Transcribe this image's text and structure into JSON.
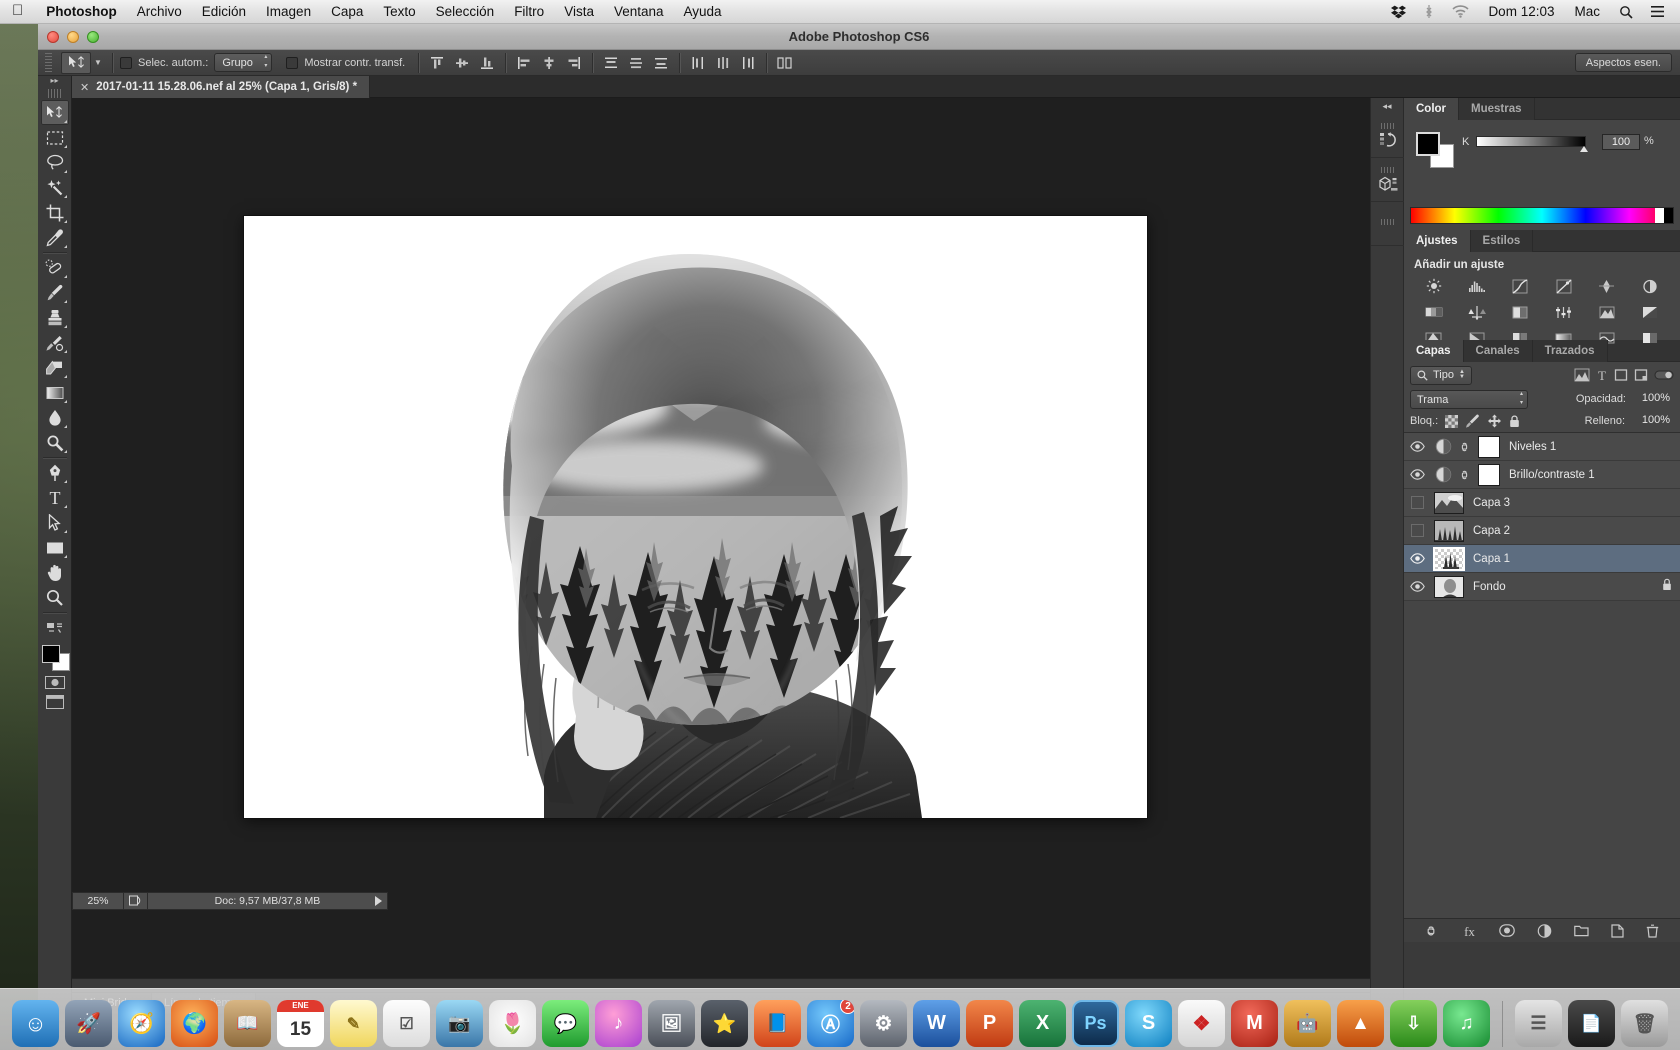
{
  "menubar": {
    "apple": "apple-logo",
    "items": [
      {
        "label": "Photoshop",
        "bold": true
      },
      {
        "label": "Archivo",
        "bold": false
      },
      {
        "label": "Edición",
        "bold": false
      },
      {
        "label": "Imagen",
        "bold": false
      },
      {
        "label": "Capa",
        "bold": false
      },
      {
        "label": "Texto",
        "bold": false
      },
      {
        "label": "Selección",
        "bold": false
      },
      {
        "label": "Filtro",
        "bold": false
      },
      {
        "label": "Vista",
        "bold": false
      },
      {
        "label": "Ventana",
        "bold": false
      },
      {
        "label": "Ayuda",
        "bold": false
      }
    ],
    "status_icons": [
      "dropbox-icon",
      "bluetooth-icon",
      "wifi-icon"
    ],
    "clock": "Dom 12:03",
    "user": "Mac",
    "right_icons": [
      "search-icon",
      "notification-center-icon"
    ]
  },
  "window": {
    "title": "Adobe Photoshop CS6"
  },
  "options_bar": {
    "tool_icon": "move-tool-icon",
    "auto_select_label": "Selec. autom.:",
    "auto_select_value": "Grupo",
    "auto_select_checked": false,
    "show_transform_label": "Mostrar contr. transf.",
    "show_transform_checked": false,
    "workspace_button": "Aspectos esen."
  },
  "document_tab": {
    "label": "2017-01-11 15.28.06.nef al 25% (Capa 1, Gris/8) *",
    "close_icon": "close-icon"
  },
  "toolbox": {
    "tools": [
      {
        "name": "move-tool",
        "selected": true
      },
      {
        "name": "rectangular-marquee-tool",
        "selected": false
      },
      {
        "name": "lasso-tool",
        "selected": false
      },
      {
        "name": "magic-wand-tool",
        "selected": false
      },
      {
        "name": "crop-tool",
        "selected": false
      },
      {
        "name": "eyedropper-tool",
        "selected": false
      },
      {
        "name": "spot-healing-brush-tool",
        "selected": false
      },
      {
        "name": "brush-tool",
        "selected": false
      },
      {
        "name": "clone-stamp-tool",
        "selected": false
      },
      {
        "name": "history-brush-tool",
        "selected": false
      },
      {
        "name": "eraser-tool",
        "selected": false
      },
      {
        "name": "gradient-tool",
        "selected": false
      },
      {
        "name": "blur-tool",
        "selected": false
      },
      {
        "name": "dodge-tool",
        "selected": false
      },
      {
        "name": "pen-tool",
        "selected": false
      },
      {
        "name": "horizontal-type-tool",
        "selected": false
      },
      {
        "name": "path-selection-tool",
        "selected": false
      },
      {
        "name": "rectangle-tool",
        "selected": false
      },
      {
        "name": "hand-tool",
        "selected": false
      },
      {
        "name": "zoom-tool",
        "selected": false
      }
    ],
    "foreground_color": "#000000",
    "background_color": "#ffffff",
    "quick_mask_icon": "quick-mask-icon",
    "screen_mode_icon": "screen-mode-icon"
  },
  "status_bar": {
    "zoom": "25%",
    "doc_info": "Doc: 9,57 MB/37,8 MB"
  },
  "mini_bridge": {
    "tabs": [
      {
        "label": "Mini Bridge",
        "active": true
      },
      {
        "label": "Línea de tiempo",
        "active": false
      }
    ]
  },
  "color_panel": {
    "tabs": [
      {
        "label": "Color",
        "active": true
      },
      {
        "label": "Muestras",
        "active": false
      }
    ],
    "channel_label": "K",
    "channel_value": "100",
    "percent": "%",
    "foreground": "#000000",
    "background": "#ffffff"
  },
  "adjustments_panel": {
    "tabs": [
      {
        "label": "Ajustes",
        "active": true
      },
      {
        "label": "Estilos",
        "active": false
      }
    ],
    "title": "Añadir un ajuste",
    "icons": [
      "brightness-contrast-icon",
      "levels-icon",
      "curves-icon",
      "exposure-icon",
      "vibrance-icon",
      "hue-saturation-icon",
      "color-balance-icon",
      "black-white-icon",
      "photo-filter-icon",
      "channel-mixer-icon",
      "color-lookup-icon",
      "invert-icon",
      "posterize-icon",
      "threshold-icon",
      "selective-color-icon",
      "gradient-map-icon",
      "map-icon",
      "solid-color-icon"
    ]
  },
  "layers_panel": {
    "tabs": [
      {
        "label": "Capas",
        "active": true
      },
      {
        "label": "Canales",
        "active": false
      },
      {
        "label": "Trazados",
        "active": false
      }
    ],
    "filter_label": "Tipo",
    "filter_icon": "search-icon",
    "blend_mode": "Trama",
    "opacity_label": "Opacidad:",
    "opacity_value": "100%",
    "lock_label": "Bloq.:",
    "lock_icons": [
      "lock-transparency-icon",
      "lock-image-icon",
      "lock-position-icon",
      "lock-all-icon"
    ],
    "fill_label": "Relleno:",
    "fill_value": "100%",
    "layers": [
      {
        "name": "Niveles 1",
        "visible": true,
        "type": "adjustment",
        "selected": false,
        "locked": false,
        "has_mask": true
      },
      {
        "name": "Brillo/contraste 1",
        "visible": true,
        "type": "adjustment",
        "selected": false,
        "locked": false,
        "has_mask": true
      },
      {
        "name": "Capa 3",
        "visible": false,
        "type": "raster",
        "selected": false,
        "locked": false,
        "has_mask": false
      },
      {
        "name": "Capa 2",
        "visible": false,
        "type": "raster",
        "selected": false,
        "locked": false,
        "has_mask": false
      },
      {
        "name": "Capa 1",
        "visible": true,
        "type": "raster",
        "selected": true,
        "locked": false,
        "has_mask": false
      },
      {
        "name": "Fondo",
        "visible": true,
        "type": "raster",
        "selected": false,
        "locked": true,
        "has_mask": false
      }
    ],
    "footer_icons": [
      "link-layers-icon",
      "layer-style-icon",
      "add-mask-icon",
      "new-adjustment-icon",
      "new-group-icon",
      "new-layer-icon",
      "delete-layer-icon"
    ]
  },
  "dock": {
    "apps": [
      {
        "name": "finder",
        "label": "",
        "color1": "#4da3e8",
        "color2": "#1f6fb5",
        "running": true
      },
      {
        "name": "launchpad",
        "label": "",
        "color1": "#7e8fa3",
        "color2": "#4a5a70",
        "running": false
      },
      {
        "name": "safari",
        "label": "",
        "color1": "#4fc3f7",
        "color2": "#1565c0",
        "running": false
      },
      {
        "name": "firefox",
        "label": "",
        "color1": "#ff9a3c",
        "color2": "#d64b12",
        "running": true
      },
      {
        "name": "contacts",
        "label": "",
        "color1": "#c8a470",
        "color2": "#8d6a3c",
        "running": false
      },
      {
        "name": "calendar",
        "label": "15",
        "color1": "#ffffff",
        "color2": "#e8e8e8",
        "running": false,
        "header": "ENE"
      },
      {
        "name": "notes",
        "label": "",
        "color1": "#fff6c0",
        "color2": "#f2d96a",
        "running": false
      },
      {
        "name": "reminders",
        "label": "",
        "color1": "#fdfdfd",
        "color2": "#dcdcdc",
        "running": false
      },
      {
        "name": "photo-booth",
        "label": "",
        "color1": "#8fd0f0",
        "color2": "#3a76a8",
        "running": false
      },
      {
        "name": "photos",
        "label": "",
        "color1": "#f8f8f8",
        "color2": "#dadada",
        "running": true
      },
      {
        "name": "messages",
        "label": "",
        "color1": "#6fe06f",
        "color2": "#1f9b2f",
        "running": false
      },
      {
        "name": "itunes",
        "label": "",
        "color1": "#ff7cc4",
        "color2": "#b03fd0",
        "running": false
      },
      {
        "name": "image-capture",
        "label": "",
        "color1": "#8a8f96",
        "color2": "#4a4f58",
        "running": false
      },
      {
        "name": "imovie",
        "label": "",
        "color1": "#4a4f58",
        "color2": "#22252a",
        "running": false
      },
      {
        "name": "ibooks",
        "label": "",
        "color1": "#ff8a3d",
        "color2": "#d1431a",
        "running": false
      },
      {
        "name": "app-store",
        "label": "",
        "color1": "#4fb3f7",
        "color2": "#1769c8",
        "running": false,
        "badge": "2"
      },
      {
        "name": "system-preferences",
        "label": "",
        "color1": "#a8adb5",
        "color2": "#5d636d",
        "running": false
      },
      {
        "name": "microsoft-word",
        "label": "W",
        "color1": "#4a8fdc",
        "color2": "#1b4f9c",
        "running": false
      },
      {
        "name": "microsoft-powerpoint",
        "label": "P",
        "color1": "#e8703a",
        "color2": "#c03a12",
        "running": false
      },
      {
        "name": "microsoft-excel",
        "label": "X",
        "color1": "#3ba35b",
        "color2": "#17733a",
        "running": false
      },
      {
        "name": "adobe-photoshop",
        "label": "Ps",
        "color1": "#2b5c8a",
        "color2": "#0d2b4a",
        "running": true
      },
      {
        "name": "skype",
        "label": "S",
        "color1": "#4fc0f0",
        "color2": "#0d7fc0",
        "running": false
      },
      {
        "name": "adobe-acrobat",
        "label": "",
        "color1": "#f0f0f0",
        "color2": "#d4d4d4",
        "running": false
      },
      {
        "name": "mega",
        "label": "M",
        "color1": "#e04a3a",
        "color2": "#a61f12",
        "running": false
      },
      {
        "name": "automator",
        "label": "",
        "color1": "#e8b04a",
        "color2": "#b07a1a",
        "running": false
      },
      {
        "name": "vlc",
        "label": "",
        "color1": "#f08a2a",
        "color2": "#c04a0a",
        "running": false
      },
      {
        "name": "utorrent",
        "label": "",
        "color1": "#6fc04a",
        "color2": "#2a8a1a",
        "running": false
      },
      {
        "name": "spotify",
        "label": "",
        "color1": "#4fd06a",
        "color2": "#168a30",
        "running": true
      }
    ],
    "right_items": [
      {
        "name": "downloads-stack",
        "color1": "#d8d8d8",
        "color2": "#a8a8a8"
      },
      {
        "name": "documents-stack",
        "color1": "#3a3a3a",
        "color2": "#1a1a1a"
      },
      {
        "name": "trash",
        "color1": "#d0d0d0",
        "color2": "#9a9a9a"
      }
    ]
  }
}
